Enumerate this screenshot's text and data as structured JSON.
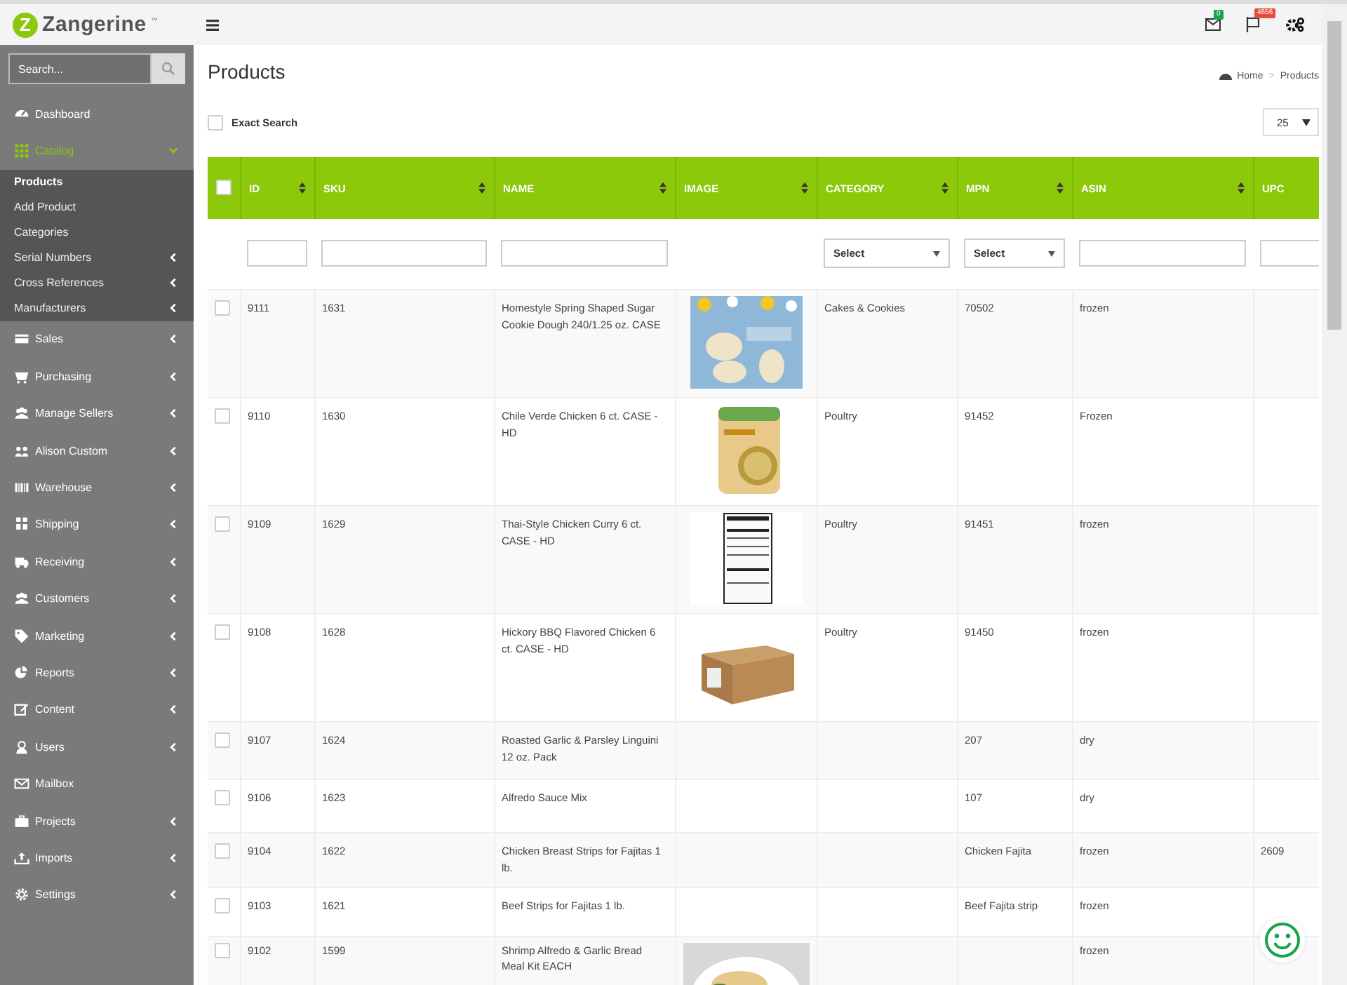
{
  "logo": {
    "mark": "Z",
    "name": "Zangerine",
    "tm": "™"
  },
  "sidebar": {
    "search": {
      "placeholder": "Search..."
    },
    "items": [
      {
        "label": "Dashboard",
        "expandable": false,
        "expanded": false
      },
      {
        "label": "Catalog",
        "expandable": true,
        "expanded": true,
        "children": [
          {
            "label": "Products",
            "selected": true,
            "expandable": false
          },
          {
            "label": "Add Product",
            "selected": false,
            "expandable": false
          },
          {
            "label": "Categories",
            "selected": false,
            "expandable": false
          },
          {
            "label": "Serial Numbers",
            "selected": false,
            "expandable": true
          },
          {
            "label": "Cross References",
            "selected": false,
            "expandable": true
          },
          {
            "label": "Manufacturers",
            "selected": false,
            "expandable": true
          }
        ]
      },
      {
        "label": "Sales",
        "expandable": true,
        "expanded": false
      },
      {
        "label": "Purchasing",
        "expandable": true,
        "expanded": false
      },
      {
        "label": "Manage Sellers",
        "expandable": true,
        "expanded": false
      },
      {
        "label": "Alison Custom",
        "expandable": true,
        "expanded": false
      },
      {
        "label": "Warehouse",
        "expandable": true,
        "expanded": false
      },
      {
        "label": "Shipping",
        "expandable": true,
        "expanded": false
      },
      {
        "label": "Receiving",
        "expandable": true,
        "expanded": false
      },
      {
        "label": "Customers",
        "expandable": true,
        "expanded": false
      },
      {
        "label": "Marketing",
        "expandable": true,
        "expanded": false
      },
      {
        "label": "Reports",
        "expandable": true,
        "expanded": false
      },
      {
        "label": "Content",
        "expandable": true,
        "expanded": false
      },
      {
        "label": "Users",
        "expandable": true,
        "expanded": false
      },
      {
        "label": "Mailbox",
        "expandable": false,
        "expanded": false
      },
      {
        "label": "Projects",
        "expandable": true,
        "expanded": false
      },
      {
        "label": "Imports",
        "expandable": true,
        "expanded": false
      },
      {
        "label": "Settings",
        "expandable": true,
        "expanded": false
      }
    ]
  },
  "topbar": {
    "mail_badge": "0",
    "flag_badge": "4656"
  },
  "page": {
    "title": "Products",
    "breadcrumb": {
      "home": "Home",
      "separator": ">",
      "current": "Products"
    },
    "exact_search": {
      "label": "Exact Search",
      "checked": false
    },
    "page_size": "25"
  },
  "table": {
    "select_all_checked": false,
    "columns": [
      {
        "label": "ID",
        "filter": {
          "kind": "text"
        }
      },
      {
        "label": "SKU",
        "filter": {
          "kind": "text"
        }
      },
      {
        "label": "NAME",
        "filter": {
          "kind": "text"
        }
      },
      {
        "label": "IMAGE"
      },
      {
        "label": "CATEGORY",
        "filter": {
          "kind": "select",
          "value": "Select"
        }
      },
      {
        "label": "MPN",
        "filter": {
          "kind": "select",
          "value": "Select"
        }
      },
      {
        "label": "ASIN",
        "filter": {
          "kind": "text"
        }
      },
      {
        "label": "UPC",
        "filter": {
          "kind": "text"
        }
      }
    ],
    "rows": [
      {
        "checked": false,
        "image": true,
        "cells": [
          "9111",
          "1631",
          "Homestyle Spring Shaped Sugar Cookie Dough 240/1.25 oz. CASE",
          "",
          "Cakes & Cookies",
          "70502",
          "frozen",
          ""
        ]
      },
      {
        "checked": false,
        "image": true,
        "cells": [
          "9110",
          "1630",
          "Chile Verde Chicken 6 ct. CASE - HD",
          "",
          "Poultry",
          "91452",
          "Frozen",
          ""
        ]
      },
      {
        "checked": false,
        "image": true,
        "cells": [
          "9109",
          "1629",
          "Thai-Style Chicken Curry 6 ct. CASE - HD",
          "",
          "Poultry",
          "91451",
          "frozen",
          ""
        ]
      },
      {
        "checked": false,
        "image": true,
        "cells": [
          "9108",
          "1628",
          "Hickory BBQ Flavored Chicken 6 ct. CASE - HD",
          "",
          "Poultry",
          "91450",
          "frozen",
          ""
        ]
      },
      {
        "checked": false,
        "image": false,
        "cells": [
          "9107",
          "1624",
          "Roasted Garlic & Parsley Linguini 12 oz. Pack",
          "",
          "",
          "207",
          "dry",
          ""
        ]
      },
      {
        "checked": false,
        "image": false,
        "cells": [
          "9106",
          "1623",
          "Alfredo Sauce Mix",
          "",
          "",
          "107",
          "dry",
          ""
        ]
      },
      {
        "checked": false,
        "image": false,
        "cells": [
          "9104",
          "1622",
          "Chicken Breast Strips for Fajitas 1 lb.",
          "",
          "",
          "Chicken Fajita",
          "frozen",
          "2609"
        ]
      },
      {
        "checked": false,
        "image": false,
        "cells": [
          "9103",
          "1621",
          "Beef Strips for Fajitas 1 lb.",
          "",
          "",
          "Beef Fajita strip",
          "frozen",
          ""
        ]
      },
      {
        "checked": false,
        "image": true,
        "cells": [
          "9102",
          "1599",
          "Shrimp Alfredo & Garlic Bread Meal Kit EACH",
          "",
          "",
          "",
          "frozen",
          ""
        ]
      }
    ]
  }
}
